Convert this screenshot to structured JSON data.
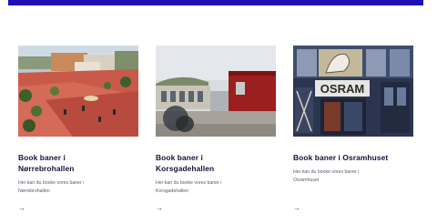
{
  "cards": [
    {
      "title_line1": "Book baner i",
      "title_line2": "Nørrebrohallen",
      "desc_line1": "Her kan du booke vores baner i",
      "desc_line2": "Nørrebrohallen",
      "arrow": "→",
      "image_icon": "town-square-photo"
    },
    {
      "title_line1": "Book baner i",
      "title_line2": "Korsgadehallen",
      "desc_line1": "Her kan du booke vores baner i",
      "desc_line2": "Korsgadehallen",
      "arrow": "→",
      "image_icon": "sports-hall-exterior-photo"
    },
    {
      "title_line1": "Book baner i Osramhuset",
      "title_line2": "",
      "desc_line1": "Her kan du booke vores baner i",
      "desc_line2": "Osramhuset",
      "arrow": "→",
      "image_icon": "osram-building-facade-photo"
    }
  ],
  "colors": {
    "top_bar": "#1f0fb5",
    "title": "#15123a",
    "desc": "#5a5a6a"
  }
}
